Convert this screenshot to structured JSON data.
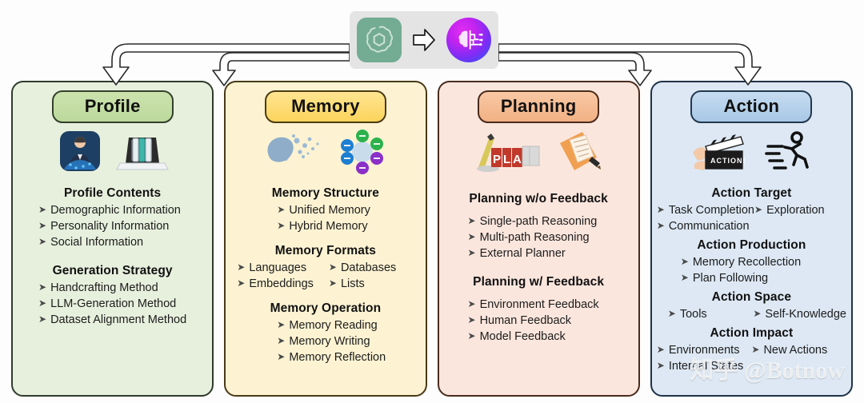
{
  "header": {
    "source_icon": "openai-logo-icon",
    "transform_icon": "arrow-right-icon",
    "target_icon": "ai-brain-icon"
  },
  "watermark": "知乎 @Botnow",
  "panels": [
    {
      "key": "profile",
      "title": "Profile",
      "icons": [
        "businessman-data-icon",
        "laptop-files-icon"
      ],
      "sections": [
        {
          "heading": "Profile Contents",
          "layout": "single",
          "items": [
            "Demographic Information",
            "Personality Information",
            "Social Information"
          ]
        },
        {
          "heading": "Generation Strategy",
          "layout": "single",
          "items": [
            "Handcrafting Method",
            "LLM-Generation Method",
            "Dataset  Alignment Method"
          ]
        }
      ]
    },
    {
      "key": "memory",
      "title": "Memory",
      "icons": [
        "brain-dissolve-icon",
        "memory-types-wheel-icon"
      ],
      "sections": [
        {
          "heading": "Memory Structure",
          "layout": "single",
          "items": [
            "Unified Memory",
            "Hybrid Memory"
          ]
        },
        {
          "heading": "Memory Formats",
          "layout": "double",
          "items": [
            "Languages",
            "Databases",
            "Embeddings",
            "Lists"
          ]
        },
        {
          "heading": "Memory Operation",
          "layout": "single",
          "items": [
            "Memory Reading",
            "Memory Writing",
            "Memory Reflection"
          ]
        }
      ]
    },
    {
      "key": "planning",
      "title": "Planning",
      "icons": [
        "plan-blocks-icon",
        "documents-pencil-icon"
      ],
      "sections": [
        {
          "heading": "Planning w/o Feedback",
          "layout": "single",
          "items": [
            "Single-path Reasoning",
            "Multi-path Reasoning",
            "External Planner"
          ]
        },
        {
          "heading": "Planning w/ Feedback",
          "layout": "single",
          "items": [
            "Environment Feedback",
            "Human Feedback",
            "Model Feedback"
          ]
        }
      ]
    },
    {
      "key": "action",
      "title": "Action",
      "icons": [
        "clapperboard-action-icon",
        "running-person-icon"
      ],
      "sections": [
        {
          "heading": "Action Target",
          "layout": "double",
          "items": [
            "Task Completion",
            "Exploration",
            "Communication",
            ""
          ]
        },
        {
          "heading": "Action Production",
          "layout": "single",
          "items": [
            "Memory Recollection",
            "Plan Following"
          ]
        },
        {
          "heading": "Action Space",
          "layout": "double",
          "items": [
            "Tools",
            "Self-Knowledge"
          ]
        },
        {
          "heading": "Action Impact",
          "layout": "double",
          "items": [
            "Environments",
            "New Actions",
            "Internal States",
            ""
          ]
        }
      ]
    }
  ],
  "colors": {
    "profile_bg": "#e7f0dd",
    "memory_bg": "#fdf3d3",
    "planning_bg": "#fbe6dd",
    "action_bg": "#dde8f4",
    "profile_pill": "#c3dda3",
    "memory_pill": "#fbd45c",
    "planning_pill": "#f2b184",
    "action_pill": "#a8c8e6",
    "connector_stroke": "#2b2b2b"
  }
}
